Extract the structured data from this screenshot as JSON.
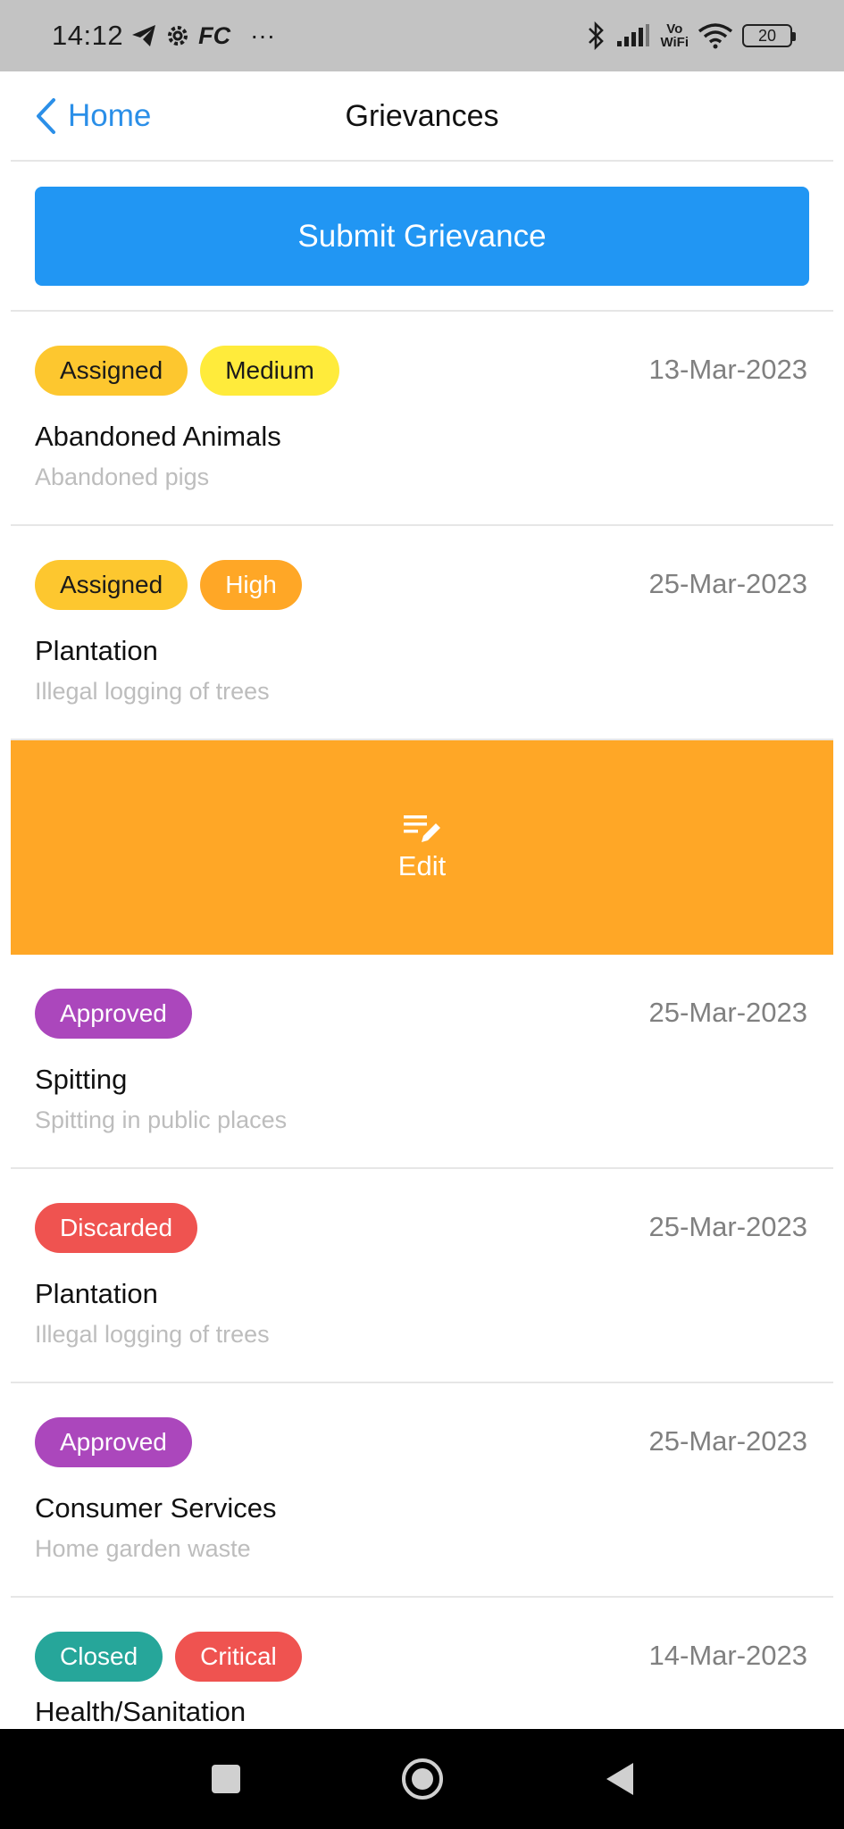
{
  "status_bar": {
    "time": "14:12",
    "fc_label": "FC",
    "more": "···",
    "network_label_top": "Vo",
    "network_label_bottom": "WiFi",
    "battery": "20"
  },
  "nav": {
    "back_label": "Home",
    "title": "Grievances"
  },
  "submit_button": "Submit Grievance",
  "edit_action": {
    "label": "Edit",
    "icon": "edit-list-icon"
  },
  "items": [
    {
      "badges": [
        {
          "label": "Assigned",
          "bg": "#fdc72f",
          "fg": "#1a1a1a"
        },
        {
          "label": "Medium",
          "bg": "#ffeb3b",
          "fg": "#1a1a1a"
        }
      ],
      "date": "13-Mar-2023",
      "title": "Abandoned Animals",
      "subtitle": "Abandoned pigs"
    },
    {
      "badges": [
        {
          "label": "Assigned",
          "bg": "#fdc72f",
          "fg": "#1a1a1a"
        },
        {
          "label": "High",
          "bg": "#ffa726",
          "fg": "#ffffff"
        }
      ],
      "date": "25-Mar-2023",
      "title": "Plantation",
      "subtitle": "Illegal logging of trees"
    },
    {
      "badges": [
        {
          "label": "Approved",
          "bg": "#ab47bc",
          "fg": "#ffffff"
        }
      ],
      "date": "25-Mar-2023",
      "title": "Spitting",
      "subtitle": "Spitting in public places"
    },
    {
      "badges": [
        {
          "label": "Discarded",
          "bg": "#ef5350",
          "fg": "#ffffff"
        }
      ],
      "date": "25-Mar-2023",
      "title": "Plantation",
      "subtitle": "Illegal logging of trees"
    },
    {
      "badges": [
        {
          "label": "Approved",
          "bg": "#ab47bc",
          "fg": "#ffffff"
        }
      ],
      "date": "25-Mar-2023",
      "title": "Consumer Services",
      "subtitle": "Home garden waste"
    },
    {
      "badges": [
        {
          "label": "Closed",
          "bg": "#26a69a",
          "fg": "#ffffff"
        },
        {
          "label": "Critical",
          "bg": "#ef5350",
          "fg": "#ffffff"
        }
      ],
      "date": "14-Mar-2023",
      "title": "Health/Sanitation",
      "subtitle": ""
    }
  ],
  "colors": {
    "primary": "#2196f3",
    "edit": "#ffa726",
    "link": "#2b8fe8"
  }
}
